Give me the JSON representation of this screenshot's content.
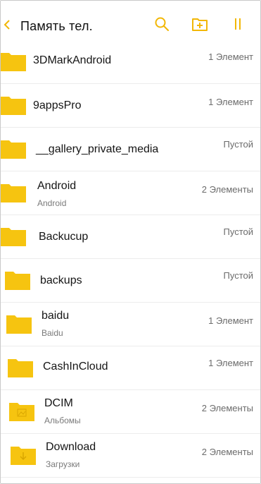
{
  "header": {
    "title": "Память тел.",
    "icons": [
      "back-arrow-icon",
      "search-icon",
      "new-folder-icon",
      "more-icon"
    ]
  },
  "colors": {
    "accent": "#F2B705",
    "folder": "#F6C410"
  },
  "items": [
    {
      "name": "3DMarkAndroid",
      "subtitle": "",
      "meta": "1 Элемент"
    },
    {
      "name": "9appsPro",
      "subtitle": "",
      "meta": "1 Элемент"
    },
    {
      "name": "__gallery_private_media",
      "subtitle": "",
      "meta": "Пустой"
    },
    {
      "name": "Android",
      "subtitle": "Android",
      "meta": "2 Элементы"
    },
    {
      "name": "Backucup",
      "subtitle": "",
      "meta": "Пустой"
    },
    {
      "name": "backups",
      "subtitle": "",
      "meta": "Пустой"
    },
    {
      "name": "baidu",
      "subtitle": "Baidu",
      "meta": "1 Элемент"
    },
    {
      "name": "CashInCloud",
      "subtitle": "",
      "meta": "1 Элемент"
    },
    {
      "name": "DCIM",
      "subtitle": "Альбомы",
      "meta": "2 Элементы"
    },
    {
      "name": "Download",
      "subtitle": "Загрузки",
      "meta": "2 Элементы"
    }
  ]
}
